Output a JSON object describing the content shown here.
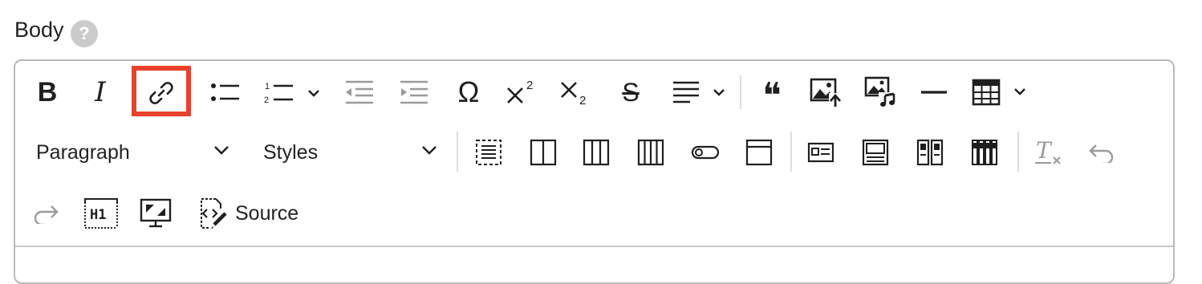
{
  "field": {
    "label": "Body",
    "help_icon": "?"
  },
  "toolbar": {
    "row1": [
      {
        "name": "bold-button",
        "icon": "bold-icon",
        "glyph": "B"
      },
      {
        "name": "italic-button",
        "icon": "italic-icon",
        "glyph": "I"
      },
      {
        "name": "link-button",
        "icon": "link-icon",
        "highlighted": true
      },
      {
        "name": "bulleted-list-button",
        "icon": "bulleted-list-icon"
      },
      {
        "name": "numbered-list-button",
        "icon": "numbered-list-icon"
      },
      {
        "name": "outdent-button",
        "icon": "outdent-icon"
      },
      {
        "name": "indent-button",
        "icon": "indent-icon"
      },
      {
        "name": "special-characters-button",
        "icon": "omega-icon",
        "glyph": "Ω"
      },
      {
        "name": "superscript-button",
        "icon": "superscript-icon",
        "glyph": "X²"
      },
      {
        "name": "subscript-button",
        "icon": "subscript-icon",
        "glyph": "X₂"
      },
      {
        "name": "strikethrough-button",
        "icon": "strikethrough-icon",
        "glyph": "S"
      },
      {
        "name": "alignment-button",
        "icon": "align-left-icon"
      },
      {
        "name": "blockquote-button",
        "icon": "blockquote-icon",
        "glyph": "❝"
      },
      {
        "name": "image-upload-button",
        "icon": "image-upload-icon"
      },
      {
        "name": "media-button",
        "icon": "media-icon"
      },
      {
        "name": "horizontal-line-button",
        "icon": "horizontal-line-icon"
      },
      {
        "name": "table-button",
        "icon": "table-icon"
      }
    ],
    "heading_select": "Paragraph",
    "styles_select": "Styles",
    "source_label": "Source",
    "heading_badge": "H1"
  },
  "colors": {
    "highlight": "#e8412b",
    "icon": "#1f1f1f",
    "disabled_icon": "#9a9a9a",
    "border": "#b9b9b9"
  }
}
